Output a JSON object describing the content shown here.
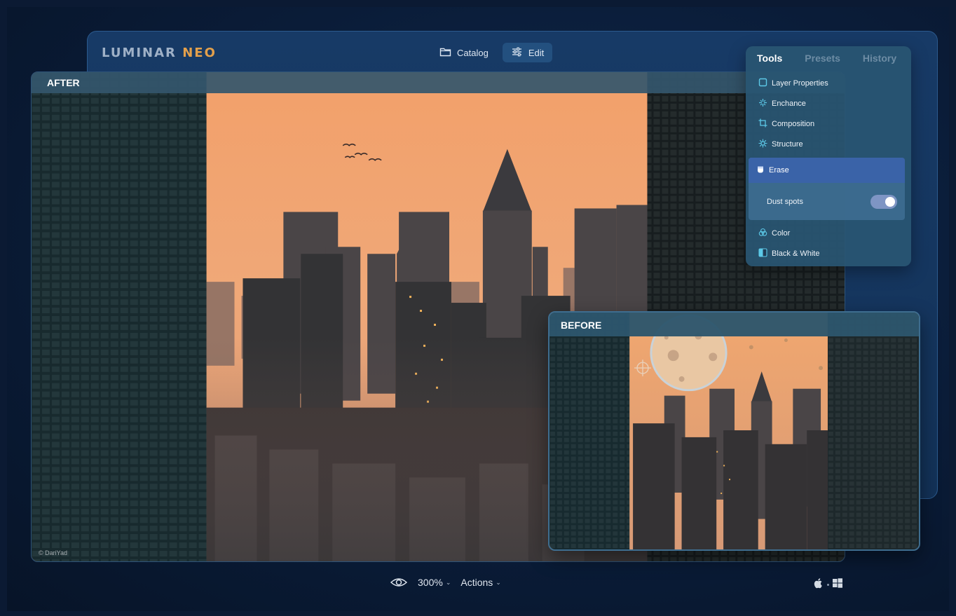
{
  "app": {
    "logo_main": "LUMINAR",
    "logo_accent": "NEO"
  },
  "top_nav": [
    {
      "label": "Catalog",
      "icon": "folder-icon",
      "active": false
    },
    {
      "label": "Edit",
      "icon": "sliders-icon",
      "active": true
    }
  ],
  "after_view": {
    "label": "AFTER",
    "credit": "© DariYad"
  },
  "before_view": {
    "label": "BEFORE"
  },
  "tools_panel": {
    "tabs": [
      {
        "label": "Tools",
        "active": true
      },
      {
        "label": "Presets",
        "active": false
      },
      {
        "label": "History",
        "active": false
      }
    ],
    "items_top": [
      {
        "label": "Layer Properties",
        "icon": "layer-square-icon"
      },
      {
        "label": "Enchance",
        "icon": "sparkle-icon"
      },
      {
        "label": "Composition",
        "icon": "crop-icon"
      },
      {
        "label": "Structure",
        "icon": "structure-icon"
      }
    ],
    "erase": {
      "label": "Erase",
      "icon": "eraser-icon",
      "dust_spots_label": "Dust spots",
      "dust_spots_enabled": true
    },
    "items_bottom": [
      {
        "label": "Color",
        "icon": "color-circles-icon"
      },
      {
        "label": "Black & White",
        "icon": "black-white-icon"
      }
    ]
  },
  "bottom_bar": {
    "preview_icon": "eye-icon",
    "zoom": "300%",
    "actions": "Actions"
  },
  "platforms": [
    "apple-icon",
    "windows-icon"
  ],
  "colors": {
    "accent_orange": "#e3a04b",
    "erase_highlight": "#3a63a8",
    "window_blue": "#173a66"
  }
}
